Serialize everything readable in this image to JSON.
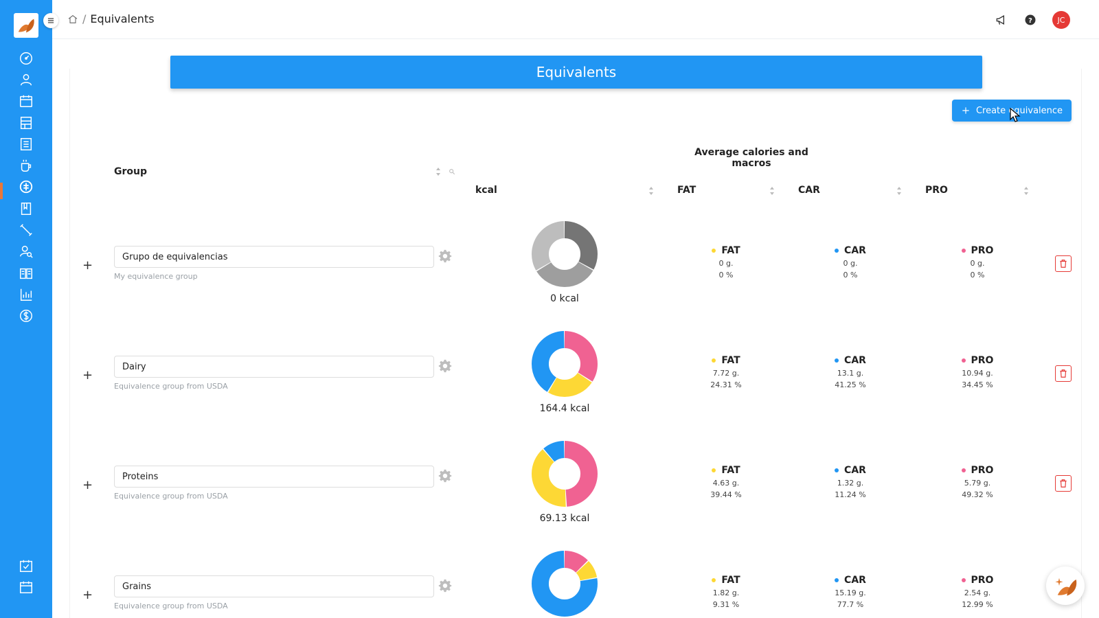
{
  "header": {
    "breadcrumb_page": "Equivalents",
    "breadcrumb_separator": "/",
    "avatar_initials": "JC"
  },
  "banner": {
    "title": "Equivalents"
  },
  "actions": {
    "create_label": "Create equivalence"
  },
  "table": {
    "group_header": "Group",
    "average_header": "Average calories and macros",
    "kcal_header": "kcal",
    "fat_header": "FAT",
    "car_header": "CAR",
    "pro_header": "PRO"
  },
  "colors": {
    "fat": "#fdd835",
    "car": "#2196f3",
    "pro": "#f06292",
    "accent": "#2196f3"
  },
  "rows": [
    {
      "name": "Grupo de equivalencias",
      "description": "My equivalence group",
      "kcal": "0 kcal",
      "fat": {
        "label": "FAT",
        "grams": "0 g.",
        "percent": "0 %"
      },
      "car": {
        "label": "CAR",
        "grams": "0 g.",
        "percent": "0 %"
      },
      "pro": {
        "label": "PRO",
        "grams": "0 g.",
        "percent": "0 %"
      },
      "chart_fractions": [
        0.333,
        0.333,
        0.334
      ],
      "chart_colors": [
        "#757575",
        "#9e9e9e",
        "#bdbdbd"
      ]
    },
    {
      "name": "Dairy",
      "description": "Equivalence group from USDA",
      "kcal": "164.4 kcal",
      "fat": {
        "label": "FAT",
        "grams": "7.72 g.",
        "percent": "24.31 %"
      },
      "car": {
        "label": "CAR",
        "grams": "13.1 g.",
        "percent": "41.25 %"
      },
      "pro": {
        "label": "PRO",
        "grams": "10.94 g.",
        "percent": "34.45 %"
      },
      "chart_fractions": [
        0.3445,
        0.2431,
        0.4125
      ],
      "chart_colors": [
        "#f06292",
        "#fdd835",
        "#2196f3"
      ]
    },
    {
      "name": "Proteins",
      "description": "Equivalence group from USDA",
      "kcal": "69.13 kcal",
      "fat": {
        "label": "FAT",
        "grams": "4.63 g.",
        "percent": "39.44 %"
      },
      "car": {
        "label": "CAR",
        "grams": "1.32 g.",
        "percent": "11.24 %"
      },
      "pro": {
        "label": "PRO",
        "grams": "5.79 g.",
        "percent": "49.32 %"
      },
      "chart_fractions": [
        0.4932,
        0.3944,
        0.1124
      ],
      "chart_colors": [
        "#f06292",
        "#fdd835",
        "#2196f3"
      ]
    },
    {
      "name": "Grains",
      "description": "Equivalence group from USDA",
      "kcal": "",
      "fat": {
        "label": "FAT",
        "grams": "1.82 g.",
        "percent": "9.31 %"
      },
      "car": {
        "label": "CAR",
        "grams": "15.19 g.",
        "percent": "77.7 %"
      },
      "pro": {
        "label": "PRO",
        "grams": "2.54 g.",
        "percent": "12.99 %"
      },
      "chart_fractions": [
        0.1299,
        0.0931,
        0.777
      ],
      "chart_colors": [
        "#f06292",
        "#fdd835",
        "#2196f3"
      ]
    }
  ],
  "sidebar_icons": [
    "dashboard-icon",
    "user-icon",
    "calendar-icon",
    "layout-icon",
    "list-icon",
    "coffee-cup-icon",
    "equivalents-icon",
    "book-icon",
    "dumbbell-icon",
    "user-search-icon",
    "recipes-book-icon",
    "bar-chart-icon",
    "dollar-icon",
    "checklist-icon",
    "calendar-bottom-icon"
  ]
}
